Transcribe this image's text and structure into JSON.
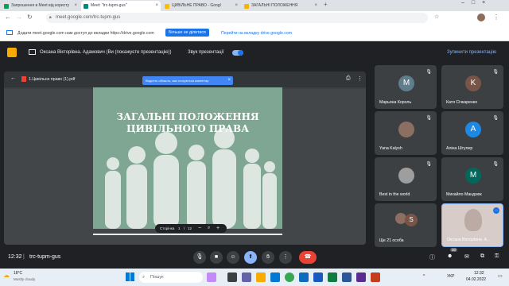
{
  "tabs": [
    {
      "label": "Запрошення в Meet від користу",
      "color": "#0f9d58"
    },
    {
      "label": "Meet: \"trc-tupm-gus\"",
      "color": "#00897b"
    },
    {
      "label": "ЦИВІЛЬНЕ ПРАВО - Googl",
      "color": "#fbbc04"
    },
    {
      "label": "ЗАГАЛЬНІ ПОЛОЖЕННЯ",
      "color": "#f4b400"
    }
  ],
  "address_bar": {
    "url": "meet.google.com/trc-tupm-gus"
  },
  "infobar": {
    "message": "Додати meet.google.com нам доступ до вкладки https://drive.google.com",
    "share_button": "Більше не ділитися",
    "switch_link": "Перейти на вкладку drive.google.com"
  },
  "meet_header": {
    "presenter_label": "Оксана Вікторівна. Адамович (Ви (покажуєте презентацію))",
    "sound_label": "Звук презентації",
    "stop_label": "Зупинити презентацію"
  },
  "document": {
    "filename": "1.Цивільне право (1).pdf",
    "tooltip": "Виділіть область, яка стосується коментар",
    "slide_title_line1": "ЗАГАЛЬНІ ПОЛОЖЕННЯ",
    "slide_title_line2": "ЦИВІЛЬНОГО ПРАВА",
    "page_label": "Сторінка",
    "page_current": "1",
    "page_sep": "/",
    "page_total": "12"
  },
  "participants": [
    {
      "name": "Марьяна Король",
      "initial": "M",
      "color": "#607d8b"
    },
    {
      "name": "Катя Січкаренко",
      "initial": "K",
      "color": "#795548"
    },
    {
      "name": "Yana Kalysh",
      "initial": "",
      "color": "#8d6e63"
    },
    {
      "name": "Аліна Штулер",
      "initial": "A",
      "color": "#1e88e5"
    },
    {
      "name": "Best in the world",
      "initial": "",
      "color": "#9e9e9e"
    },
    {
      "name": "Михайло Мандзюк",
      "initial": "M",
      "color": "#00695c"
    },
    {
      "name": "Ще 21 особа",
      "initial": "S",
      "color": "#795548"
    },
    {
      "name": "Оксана Вікторівна. А...",
      "initial": "",
      "color": "#bcaaa4"
    }
  ],
  "bottom_bar": {
    "time": "12:32",
    "separator": "|",
    "meeting_code": "trc-tupm-gus",
    "participant_count": "30"
  },
  "taskbar": {
    "weather_temp": "18°C",
    "weather_desc": "Mostly cloudy",
    "search_placeholder": "Пошук",
    "language": "УКР",
    "clock_time": "12:32",
    "clock_date": "04.02.2022"
  },
  "colors": {
    "meet_bg": "#202124",
    "tile_bg": "#3c4043",
    "accent": "#1a73e8",
    "end_call": "#ea4335",
    "slide_bg": "#7fa693"
  }
}
